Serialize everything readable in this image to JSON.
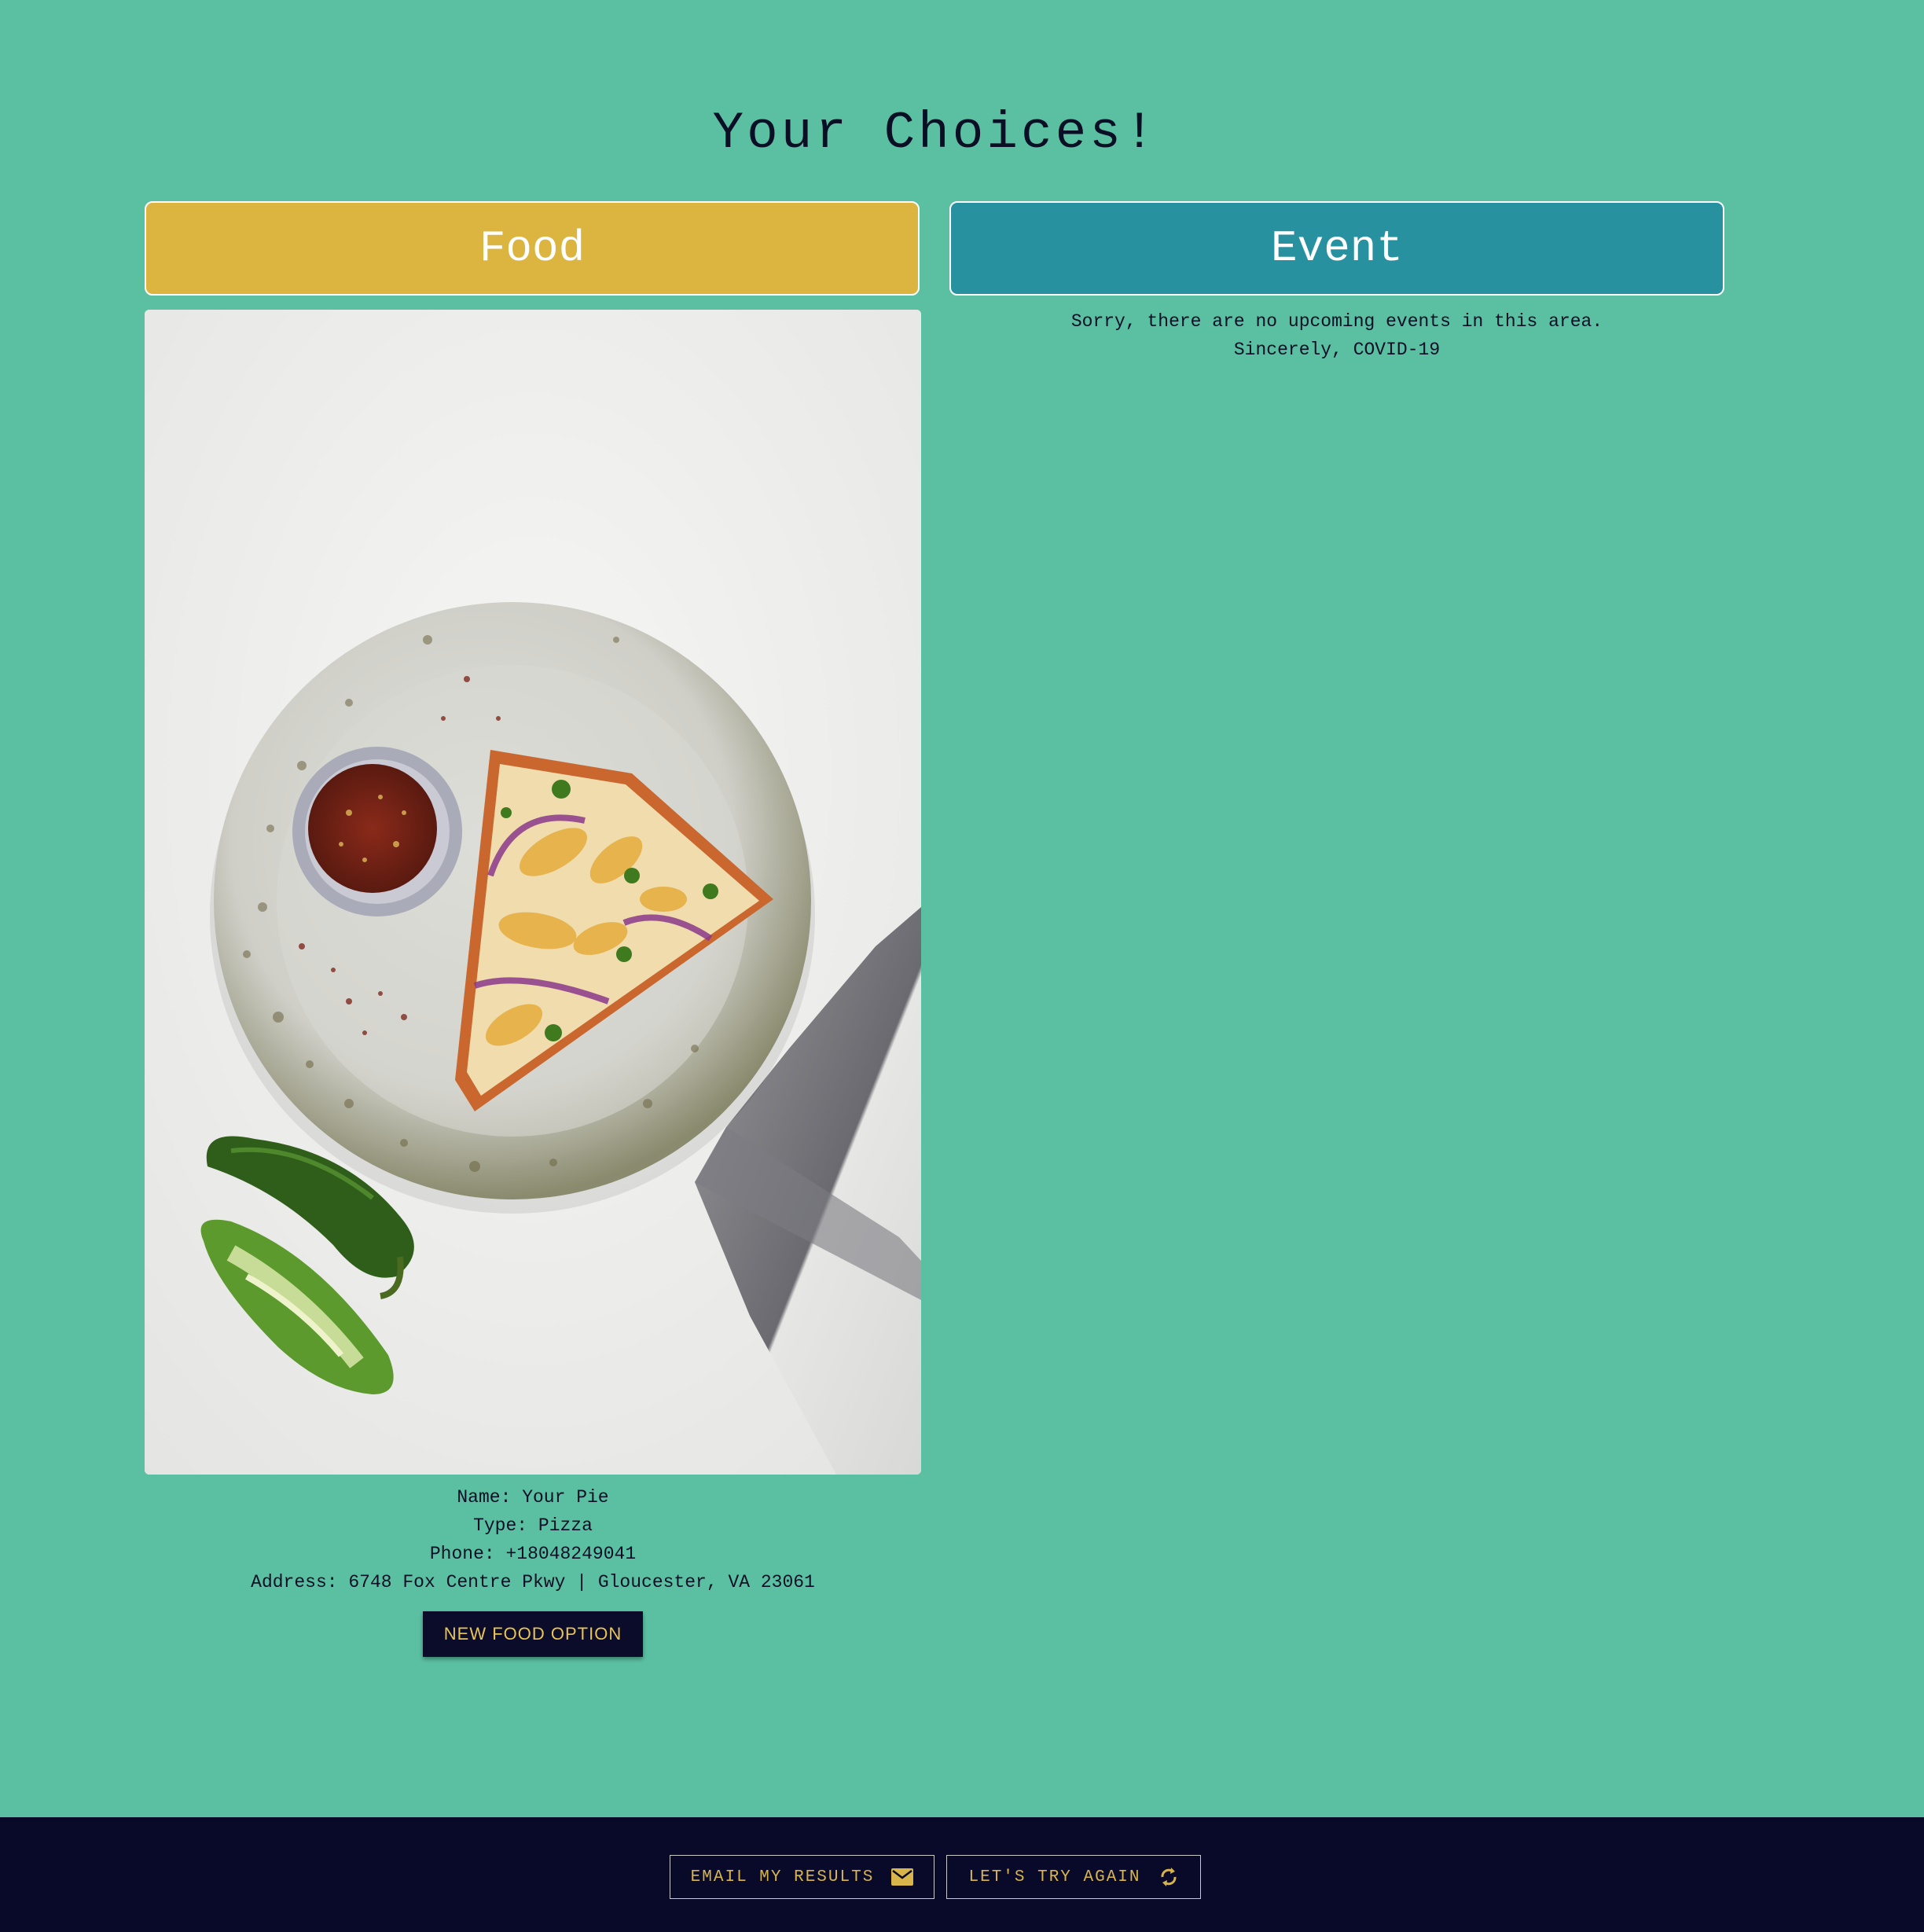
{
  "page": {
    "title": "Your Choices!"
  },
  "food": {
    "header": "Food",
    "name_line": "Name: Your Pie",
    "type_line": "Type: Pizza",
    "phone_line": "Phone: +18048249041",
    "address_line": "Address: 6748 Fox Centre Pkwy | Gloucester, VA 23061",
    "new_option_label": "NEW FOOD OPTION"
  },
  "event": {
    "header": "Event",
    "message_line1": "Sorry, there are no upcoming events in this area.",
    "message_line2": "Sincerely, COVID-19"
  },
  "footer": {
    "email_label": "EMAIL MY RESULTS",
    "email_icon": "envelope-icon",
    "retry_label": "LET'S TRY AGAIN",
    "retry_icon": "refresh-icon"
  },
  "colors": {
    "background": "#5bc0a2",
    "food_header": "#dbb53f",
    "event_header": "#2791a0",
    "footer": "#090a2a",
    "accent_text": "#d8b54a"
  }
}
